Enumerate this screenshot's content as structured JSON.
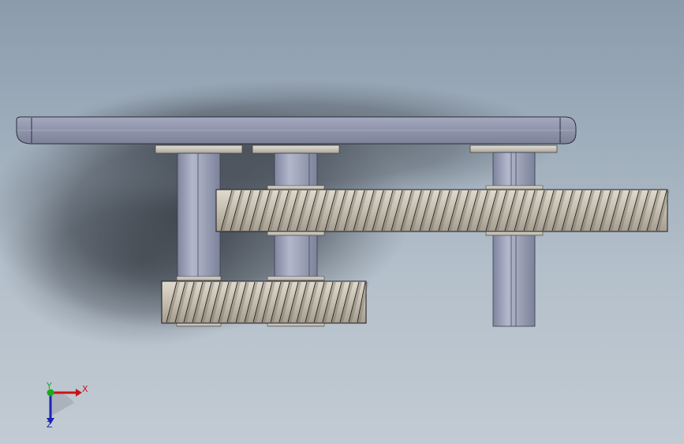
{
  "viewport": {
    "background_top": "#8b9bac",
    "background_bottom": "#c2cbd3"
  },
  "model": {
    "plate_color": "#8e93aa",
    "shaft_color": "#9aa0b8",
    "gear_color": "#c9c2b5",
    "gear_tooth_line": "#1a1a1a",
    "washer_color": "#cdc9bf"
  },
  "triad": {
    "x_label": "X",
    "y_label": "Y",
    "z_label": "Z",
    "x_color": "#c8141a",
    "y_color": "#1ca81c",
    "z_color": "#1a24b8"
  }
}
